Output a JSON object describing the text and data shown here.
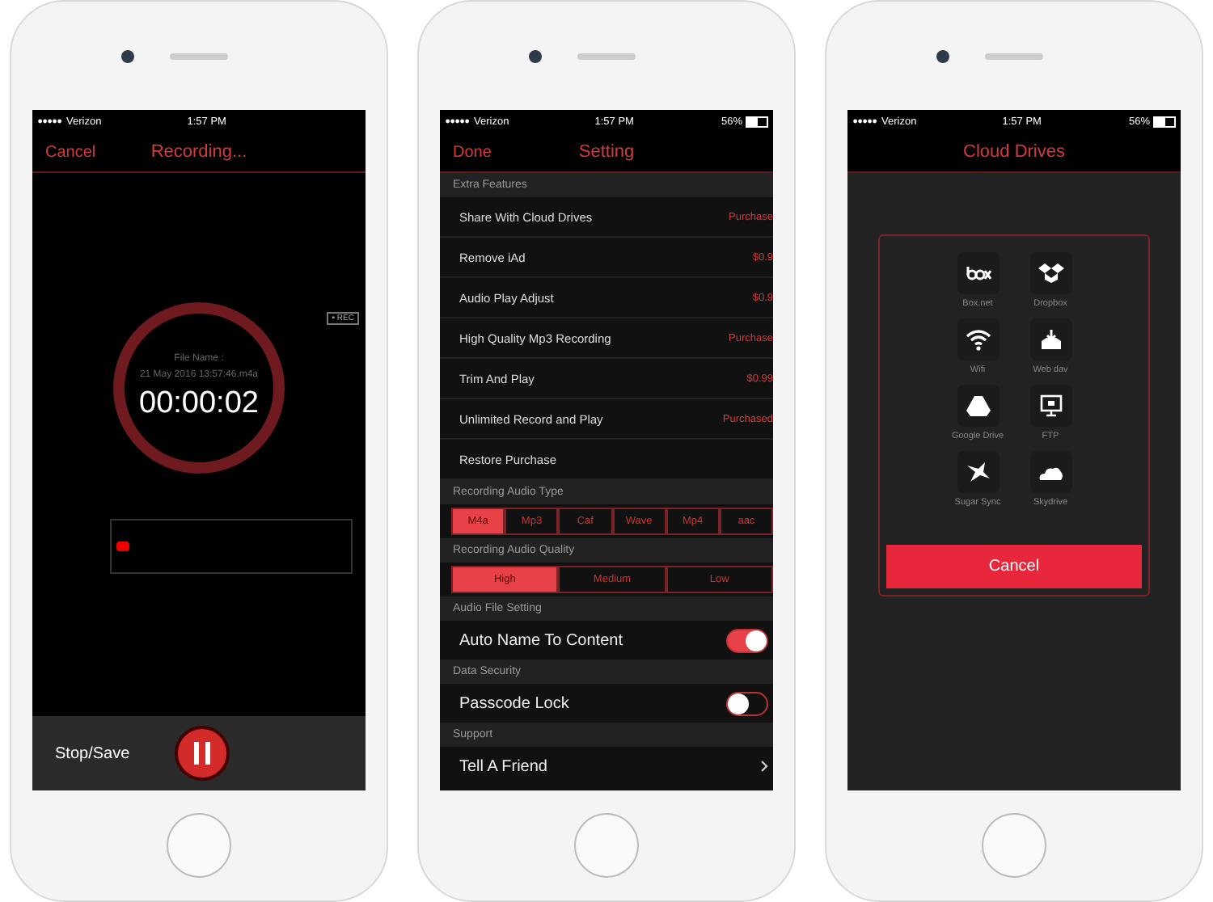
{
  "recording_screen": {
    "status_bar": {
      "carrier": "Verizon",
      "time": "1:57 PM"
    },
    "nav": {
      "left": "Cancel",
      "title": "Recording..."
    },
    "rec_tag": "• REC",
    "file_label": "File Name :",
    "file_name": "21 May 2016 13:57:46.m4a",
    "timer": "00:00:02",
    "stop_label": "Stop/Save"
  },
  "settings_screen": {
    "status_bar": {
      "carrier": "Verizon",
      "time": "1:57 PM",
      "battery": "56%"
    },
    "nav": {
      "left": "Done",
      "title": "Setting"
    },
    "sections": [
      {
        "kind": "rows",
        "header": "Extra Features",
        "rows": [
          {
            "label": "Share With Cloud Drives",
            "value": "Purchase"
          },
          {
            "label": "Remove iAd",
            "value": "$0.9"
          },
          {
            "label": "Audio Play Adjust",
            "value": "$0.9"
          },
          {
            "label": "High Quality Mp3 Recording",
            "value": "Purchase"
          },
          {
            "label": "Trim And Play",
            "value": "$0.99"
          },
          {
            "label": "Unlimited Record and Play",
            "value": "Purchased"
          },
          {
            "label": "Restore Purchase"
          }
        ]
      },
      {
        "kind": "segments",
        "header": "Recording Audio Type",
        "segments": [
          {
            "label": "M4a",
            "selected": true
          },
          {
            "label": "Mp3",
            "selected": false
          },
          {
            "label": "Caf",
            "selected": false
          },
          {
            "label": "Wave",
            "selected": false
          },
          {
            "label": "Mp4",
            "selected": false
          },
          {
            "label": "aac",
            "selected": false
          }
        ]
      },
      {
        "kind": "segments",
        "header": "Recording Audio Quality",
        "segments": [
          {
            "label": "High",
            "selected": true
          },
          {
            "label": "Medium",
            "selected": false
          },
          {
            "label": "Low",
            "selected": false
          }
        ]
      },
      {
        "kind": "toggle",
        "header": "Audio File Setting",
        "label": "Auto Name To Content",
        "on": true
      },
      {
        "kind": "toggle",
        "header": "Data Security",
        "label": "Passcode Lock",
        "on": false
      },
      {
        "kind": "link",
        "header": "Support",
        "label": "Tell A Friend"
      }
    ]
  },
  "cloud_screen": {
    "status_bar": {
      "carrier": "Verizon",
      "time": "1:57 PM",
      "battery": "56%"
    },
    "nav": {
      "title": "Cloud Drives"
    },
    "drives": [
      {
        "kind": "box",
        "label": "Box.net"
      },
      {
        "kind": "dropbox",
        "label": "Dropbox"
      },
      {
        "kind": "wifi",
        "label": "Wifi"
      },
      {
        "kind": "webdav",
        "label": "Web dav"
      },
      {
        "kind": "gdrive",
        "label": "Google Drive"
      },
      {
        "kind": "ftp",
        "label": "FTP"
      },
      {
        "kind": "sugarsync",
        "label": "Sugar Sync"
      },
      {
        "kind": "skydrive",
        "label": "Skydrive"
      }
    ],
    "cancel": "Cancel"
  }
}
